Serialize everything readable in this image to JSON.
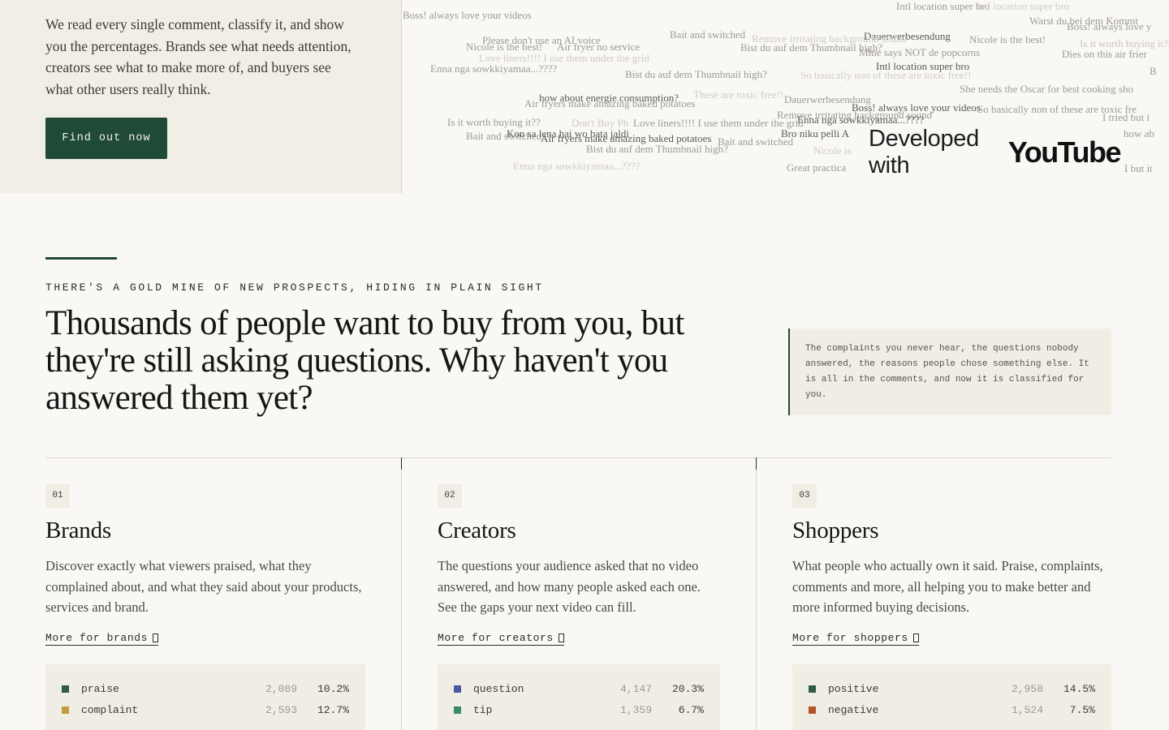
{
  "hero": {
    "description": "We read every single comment, classify it, and show you the percentages. Brands see what needs attention, creators see what to make more of, and buyers see what other users really think.",
    "cta_label": "Find out now"
  },
  "comment_cloud": [
    "Boss! always love your videos",
    "Intl location super bro",
    "Please don't use an AI voice",
    "Nicole is the best!",
    "Air fryer no service",
    "Bait and switched",
    "Dauerwerbesendung",
    "Remove irritating background sound",
    "Nicole is the best!",
    "Is it worth buying it??",
    "Warst du bei dem Kommt",
    "Boss! always love y",
    "Bist du auf dem Thumbnail high?",
    "Mine says NOT de popcorns",
    "Dies on this air frier",
    "Love liners!!!! I use them under the grid",
    "Enna nga sowkkiyamaa...????",
    "Bist du auf dem Thumbnail high?",
    "So basically non of these are toxic free!!",
    "Intl location super bro",
    "She needs the Oscar for best cooking sho",
    "how about energie consumption?",
    "These are toxic free!!",
    "Air fryers make amazing baked potatoes",
    "Dauerwerbesendung",
    "Boss! always love your videos",
    "So basically non of these are toxic fre",
    "Remove irritating background sound",
    "Enna nga sowkkiyamaa...????",
    "I tried but i",
    "Is it worth buying it??",
    "Don't Buy Ph",
    "Love liners!!!! I use them under the grid",
    "Bro niku pelli A",
    "Bait and switched",
    "Kon sa lena hai wo bata jaldi",
    "Air fryers make amazing baked potatoes",
    "Bait and switched",
    "Bist du auf dem Thumbnail high?",
    "Nicole is",
    "Enna nga sowkkiyamaa...????",
    "Great practica",
    "I but it",
    "how ab",
    "Intl location super bro",
    "Is it worth buyi",
    "B"
  ],
  "youtube_badge": {
    "prefix": "Developed with",
    "brand": "YouTube"
  },
  "section": {
    "eyebrow": "THERE'S A GOLD MINE OF NEW PROSPECTS, HIDING IN PLAIN SIGHT",
    "headline": "Thousands of people want to buy from you, but they're still asking questions. Why haven't you answered them yet?",
    "quote": "The complaints you never hear, the questions nobody answered, the reasons people chose something else. It is all in the comments, and now it is classified for you."
  },
  "cards": [
    {
      "number": "01",
      "title": "Brands",
      "body": "Discover exactly what viewers praised, what they complained about, and what they said about your products, services and brand.",
      "link": "More for brands",
      "stats": [
        {
          "label": "praise",
          "count": "2,089",
          "pct": "10.2%",
          "color": "#2f5a44"
        },
        {
          "label": "complaint",
          "count": "2,593",
          "pct": "12.7%",
          "color": "#c39a3e"
        }
      ]
    },
    {
      "number": "02",
      "title": "Creators",
      "body": "The questions your audience asked that no video answered, and how many people asked each one. See the gaps your next video can fill.",
      "link": "More for creators",
      "stats": [
        {
          "label": "question",
          "count": "4,147",
          "pct": "20.3%",
          "color": "#4a58a6"
        },
        {
          "label": "tip",
          "count": "1,359",
          "pct": "6.7%",
          "color": "#3d8a68"
        }
      ]
    },
    {
      "number": "03",
      "title": "Shoppers",
      "body": "What people who actually own it said. Praise, complaints, comments and more, all helping you to make better and more informed buying decisions.",
      "link": "More for shoppers",
      "stats": [
        {
          "label": "positive",
          "count": "2,958",
          "pct": "14.5%",
          "color": "#2f5a44"
        },
        {
          "label": "negative",
          "count": "1,524",
          "pct": "7.5%",
          "color": "#b4552d"
        }
      ]
    }
  ]
}
